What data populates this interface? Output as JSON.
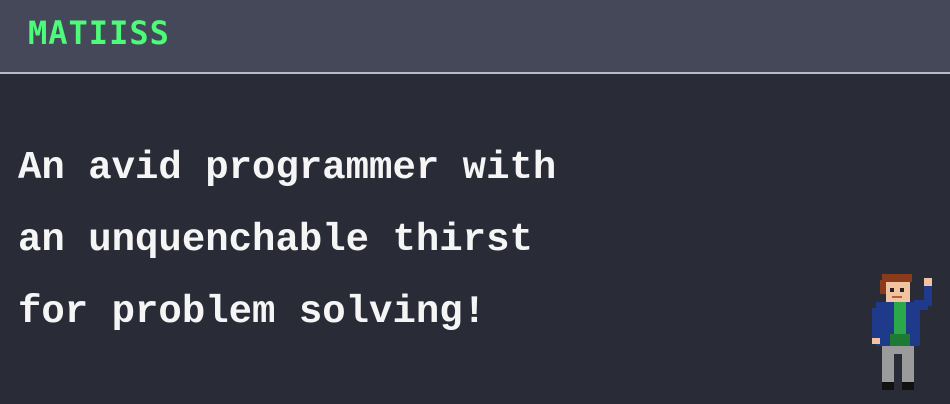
{
  "header": {
    "logo_text": "MATIISS"
  },
  "hero": {
    "lines": [
      "An avid programmer with",
      "an unquenchable thirst",
      "for problem solving!"
    ]
  },
  "avatar": {
    "icon": "pixel-character-waving-icon",
    "colors": {
      "hair": "#8a3b1c",
      "skin": "#f2c3a1",
      "jacket": "#1f3a8a",
      "shirt": "#2aa84a",
      "pants": "#9b9b9b",
      "shoes": "#111111"
    }
  },
  "theme": {
    "background": "#292b36",
    "header_background": "#444859",
    "accent": "#4dfa7a",
    "text": "#f5f5f5"
  }
}
